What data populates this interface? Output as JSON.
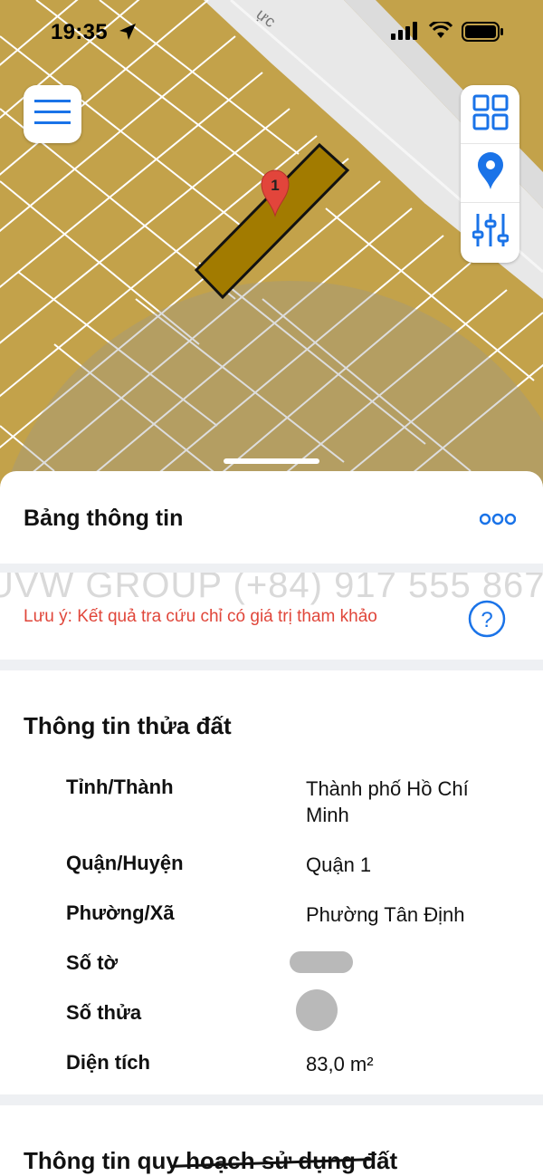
{
  "status_bar": {
    "time": "19:35"
  },
  "map": {
    "street_label": "ực",
    "marker_label": "1",
    "colors": {
      "land": "#c3a24a",
      "parcel_selected": "#a27b00",
      "road": "#e9e9e9",
      "marker": "#e2453b",
      "accent": "#1a73e8"
    }
  },
  "sheet": {
    "title": "Bảng thông tin",
    "watermark": "UVW GROUP (+84) 917 555 867",
    "note": "Lưu ý: Kết quả tra cứu chỉ có giá trị tham khảo",
    "parcel_section": {
      "title": "Thông tin thửa đất",
      "rows": [
        {
          "label": "Tỉnh/Thành",
          "value": "Thành phố Hồ Chí Minh"
        },
        {
          "label": "Quận/Huyện",
          "value": "Quận 1"
        },
        {
          "label": "Phường/Xã",
          "value": "Phường Tân Định"
        },
        {
          "label": "Số tờ",
          "value": ""
        },
        {
          "label": "Số thửa",
          "value": ""
        },
        {
          "label": "Diện tích",
          "value": "83,0 m²"
        }
      ]
    },
    "planning_section": {
      "title": "Thông tin quy hoạch sử dụng đất"
    }
  },
  "icons": [
    "location-arrow-icon",
    "signal-icon",
    "wifi-icon",
    "battery-icon",
    "menu-icon",
    "grid-icon",
    "map-pin-icon",
    "sliders-icon",
    "more-icon",
    "help-icon",
    "map-marker-icon"
  ]
}
